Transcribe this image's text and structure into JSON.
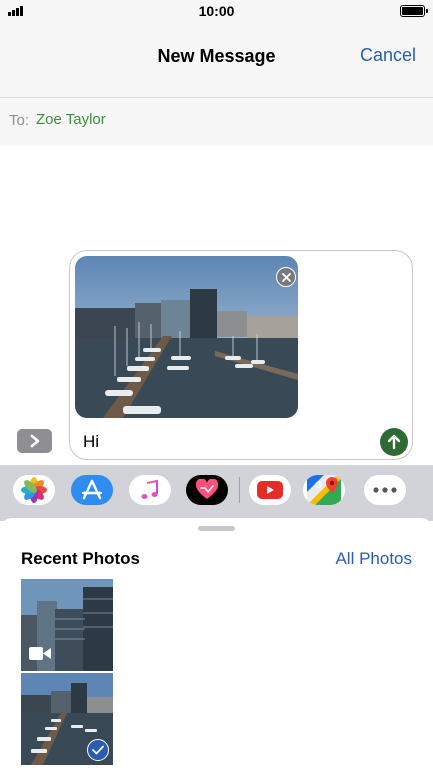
{
  "status_bar": {
    "time": "10:00",
    "battery_level": 1.0
  },
  "header": {
    "title": "New Message",
    "cancel_label": "Cancel"
  },
  "recipient": {
    "label": "To:",
    "name": "Zoe Taylor"
  },
  "compose": {
    "message_text": "Hi",
    "attachment": "harbour-photo"
  },
  "app_drawer": {
    "apps": [
      "photos-icon",
      "app-store-icon",
      "music-icon",
      "digital-touch-icon",
      "youtube-icon",
      "google-maps-icon",
      "more-icon"
    ]
  },
  "photo_picker": {
    "title": "Recent Photos",
    "all_photos_label": "All Photos",
    "items": [
      {
        "type": "video",
        "selected": false
      },
      {
        "type": "photo",
        "selected": true
      }
    ]
  },
  "colors": {
    "accent": "#2a5db0",
    "recipient": "#3d8b3d",
    "send": "#2e6b34"
  }
}
